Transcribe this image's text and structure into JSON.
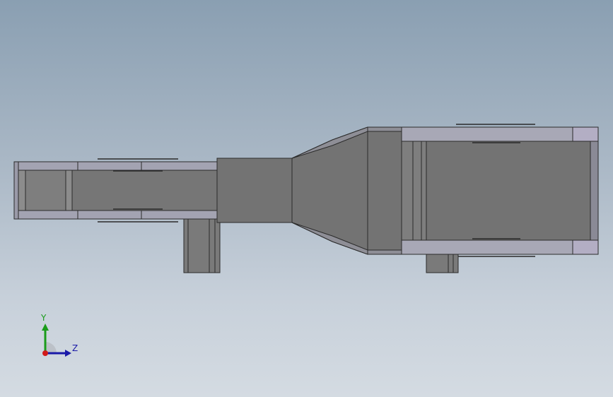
{
  "viewport": {
    "background_top": "#8a9fb2",
    "background_bottom": "#d4dbe2"
  },
  "model": {
    "body_color": "#737373",
    "edge_color": "#2b2b2b",
    "face_light": "#a0a0ac",
    "face_highlight": "#b8b4c8",
    "flange_color": "#8a8a8a"
  },
  "triad": {
    "y_label": "Y",
    "z_label": "Z",
    "y_color": "#1a9c1a",
    "z_color": "#1a1aa8",
    "x_color": "#d21a1a",
    "x_icon": "x-axis-dot-icon",
    "y_icon": "y-axis-arrow-icon",
    "z_icon": "z-axis-arrow-icon"
  }
}
